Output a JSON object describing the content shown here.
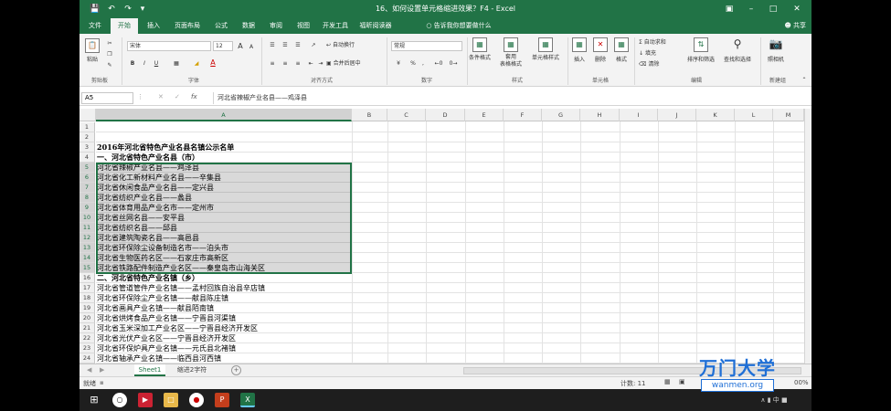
{
  "window": {
    "title": "16、如何设置单元格缩进效果？F4  -  Excel",
    "quick_access": [
      "save-icon",
      "undo-icon",
      "redo-icon"
    ]
  },
  "tabs": [
    {
      "label": "文件",
      "active": false
    },
    {
      "label": "开始",
      "active": true
    },
    {
      "label": "插入",
      "active": false
    },
    {
      "label": "页面布局",
      "active": false
    },
    {
      "label": "公式",
      "active": false
    },
    {
      "label": "数据",
      "active": false
    },
    {
      "label": "审阅",
      "active": false
    },
    {
      "label": "视图",
      "active": false
    },
    {
      "label": "开发工具",
      "active": false
    },
    {
      "label": "福昕阅读器",
      "active": false
    }
  ],
  "tell_me": "告诉我你想要做什么",
  "share": "共享",
  "ribbon": {
    "groups": [
      "剪贴板",
      "字体",
      "对齐方式",
      "数字",
      "样式",
      "单元格",
      "编辑",
      "新建组"
    ],
    "clipboard": {
      "paste": "粘贴"
    },
    "font": {
      "name": "宋体",
      "size": "12",
      "bold": "B",
      "italic": "I",
      "underline": "U",
      "grow": "A",
      "shrink": "A",
      "color_a": "A"
    },
    "alignment": {
      "wrap": "自动换行",
      "merge": "合并后居中"
    },
    "number": {
      "format": "常规",
      "percent": "%",
      "comma": ","
    },
    "styles": {
      "conditional": "条件格式",
      "table": "套用\n表格格式",
      "cell_styles": "单元格样式"
    },
    "cells": {
      "insert": "插入",
      "delete": "删除",
      "format": "格式"
    },
    "editing": {
      "autosum": "自动求和",
      "fill": "填充",
      "clear": "清除",
      "sort": "排序和筛选",
      "find": "查找和选择"
    },
    "newgroup": {
      "camera": "照相机"
    }
  },
  "formula_bar": {
    "name_box": "A5",
    "fx": "fx",
    "content": "河北省辣椒产业名县——鸡泽县"
  },
  "columns": [
    "A",
    "B",
    "C",
    "D",
    "E",
    "F",
    "G",
    "H",
    "I",
    "J",
    "K",
    "L",
    "M"
  ],
  "selected_column": "A",
  "selected_rows": [
    5,
    15
  ],
  "rows": [
    {
      "n": "1",
      "text": ""
    },
    {
      "n": "2",
      "text": ""
    },
    {
      "n": "3",
      "text": "2016年河北省特色产业名县名镇公示名单",
      "bold": true
    },
    {
      "n": "4",
      "text": "一、河北省特色产业名县（市）",
      "bold": true
    },
    {
      "n": "5",
      "text": "河北省辣椒产业名县——鸡泽县"
    },
    {
      "n": "6",
      "text": "河北省化工新材料产业名县——辛集县"
    },
    {
      "n": "7",
      "text": "河北省休闲食品产业名县——定兴县"
    },
    {
      "n": "8",
      "text": "河北省纺织产业名县——蠡县"
    },
    {
      "n": "9",
      "text": "河北省体育用品产业名市——定州市"
    },
    {
      "n": "10",
      "text": "河北省丝网名县——安平县"
    },
    {
      "n": "11",
      "text": "河北省纺织名县——邱县"
    },
    {
      "n": "12",
      "text": "河北省建筑陶瓷名县——高邑县"
    },
    {
      "n": "13",
      "text": "河北省环保除尘设备制造名市——泊头市"
    },
    {
      "n": "14",
      "text": "河北省生物医药名区——石家庄市高新区"
    },
    {
      "n": "15",
      "text": "河北省铁路配件制造产业名区——秦皇岛市山海关区"
    },
    {
      "n": "16",
      "text": "二、河北省特色产业名镇（乡）",
      "bold": true
    },
    {
      "n": "17",
      "text": "河北省管道管件产业名镇——孟村回族自治县辛店镇"
    },
    {
      "n": "18",
      "text": "河北省环保除尘产业名镇——献县陈庄镇"
    },
    {
      "n": "19",
      "text": "河北省画具产业名镇——献县陌南镇"
    },
    {
      "n": "20",
      "text": "河北省烘烤食品产业名镇——宁晋县河渠镇"
    },
    {
      "n": "21",
      "text": "河北省玉米深加工产业名区——宁晋县经济开发区"
    },
    {
      "n": "22",
      "text": "河北省光伏产业名区——宁晋县经济开发区"
    },
    {
      "n": "23",
      "text": "河北省环保炉具产业名镇——元氏县北褚镇"
    },
    {
      "n": "24",
      "text": "河北省轴承产业名镇——临西县河西镇"
    }
  ],
  "sheet_tabs": [
    {
      "label": "Sheet1",
      "active": true
    },
    {
      "label": "缩进2字符",
      "active": false
    }
  ],
  "add_sheet": "+",
  "status": {
    "left": "就绪",
    "count": "计数: 11",
    "zoom": "00%"
  },
  "watermark": {
    "brand": "万门大学",
    "url": "wanmen.org"
  },
  "colors": {
    "excel_green": "#217346",
    "selection": "#217346",
    "watermark_blue": "#1f6fd6"
  }
}
